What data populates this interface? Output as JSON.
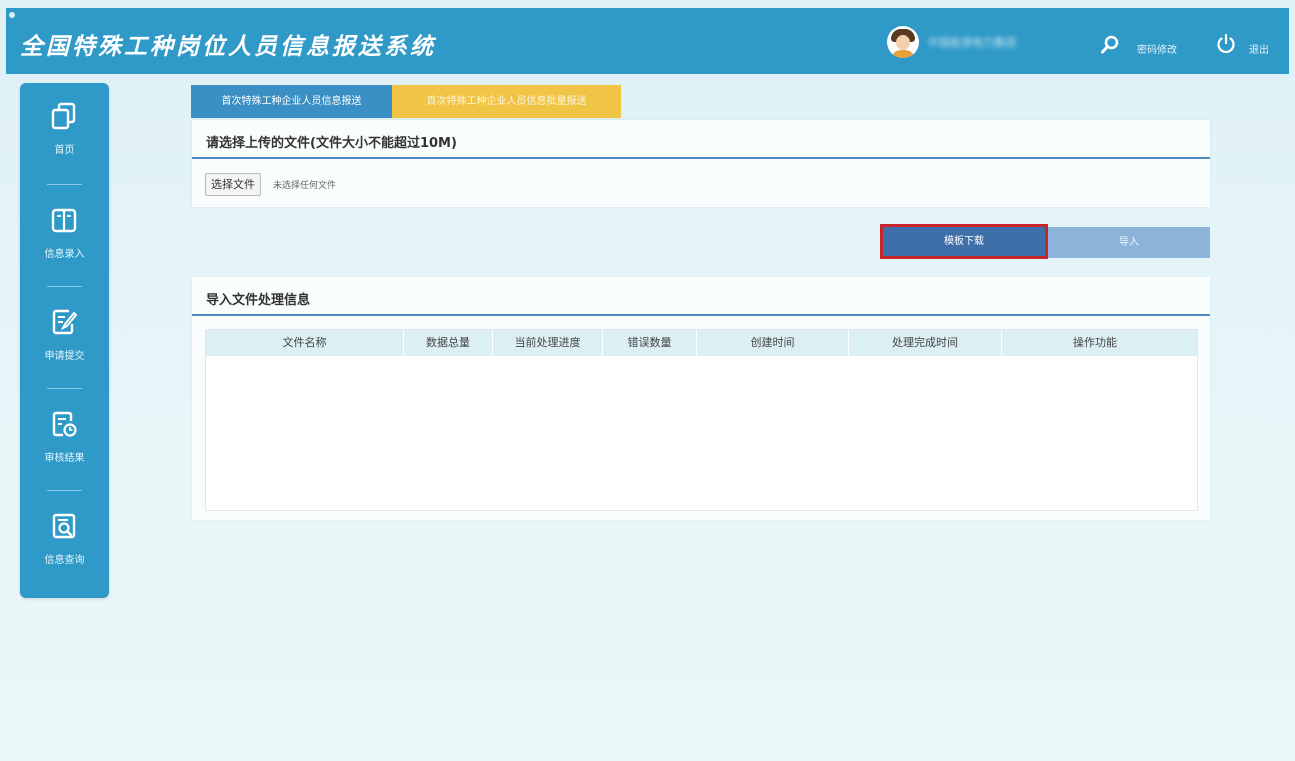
{
  "header": {
    "title": "全国特殊工种岗位人员信息报送系统",
    "username": "中国能源电力集团",
    "password_change_label": "密码修改",
    "logout_label": "退出",
    "color": "#2f9ac8"
  },
  "sidebar": {
    "items": [
      {
        "label": "首页",
        "icon": "copy-icon"
      },
      {
        "label": "信息录入",
        "icon": "book-icon"
      },
      {
        "label": "申请提交",
        "icon": "edit-document-icon"
      },
      {
        "label": "审核结果",
        "icon": "document-clock-icon"
      },
      {
        "label": "信息查询",
        "icon": "document-search-icon"
      }
    ]
  },
  "tabs": [
    {
      "label": "首次特殊工种企业人员信息报送",
      "active": true
    },
    {
      "label": "首次特殊工种企业人员信息批量报送",
      "active": false
    }
  ],
  "upload": {
    "title": "请选择上传的文件(文件大小不能超过10M)",
    "choose_button": "选择文件",
    "no_file_text": "未选择任何文件"
  },
  "actions": {
    "template_download": "模板下载",
    "import": "导入"
  },
  "processing": {
    "title": "导入文件处理信息",
    "columns": [
      "文件名称",
      "数据总量",
      "当前处理进度",
      "错误数量",
      "创建时间",
      "处理完成时间",
      "操作功能"
    ],
    "rows": []
  },
  "colors": {
    "accent": "#2f9ac8",
    "tab_active": "#3a8fc4",
    "tab_inactive": "#f0c444",
    "highlight": "#c8262b"
  }
}
